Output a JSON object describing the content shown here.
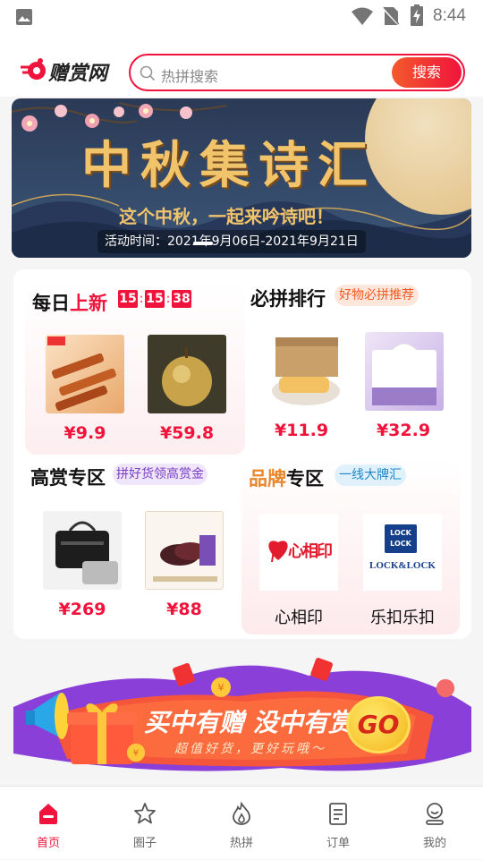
{
  "status_bar": {
    "time": "8:44"
  },
  "header": {
    "logo_text": "赠赏网",
    "search_placeholder": "热拼搜索",
    "search_button": "搜索"
  },
  "banner": {
    "title": "中秋集诗汇",
    "subtitle": "这个中秋，一起来吟诗吧！",
    "date_text": "活动时间：2021年9月06日-2021年9月21日"
  },
  "daily_new": {
    "title_a": "每日",
    "title_b": "上新",
    "countdown": [
      "15",
      "15",
      "38"
    ],
    "items": [
      {
        "price": "¥9.9"
      },
      {
        "price": "¥59.8"
      }
    ]
  },
  "must_group": {
    "title": "必拼排行",
    "tag": "好物必拼推荐",
    "items": [
      {
        "price": "¥11.9"
      },
      {
        "price": "¥32.9"
      }
    ]
  },
  "high_reward": {
    "title": "高赏专区",
    "tag": "拼好货领高赏金",
    "items": [
      {
        "price": "¥269"
      },
      {
        "price": "¥88"
      }
    ]
  },
  "brand_zone": {
    "title_a": "品牌",
    "title_b": "专区",
    "tag": "一线大牌汇",
    "brands": [
      {
        "name": "心相印",
        "logo_text": "心相印"
      },
      {
        "name": "乐扣乐扣",
        "logo_text_top": "LOCK",
        "logo_text_mid": "LOCK",
        "logo_text_bottom": "LOCK&LOCK"
      }
    ]
  },
  "promo": {
    "headline": "买中有赠 没中有赏",
    "sub": "超值好货，更好玩哦～",
    "go": "GO"
  },
  "tabs": [
    {
      "label": "首页",
      "icon": "home-icon",
      "active": true
    },
    {
      "label": "圈子",
      "icon": "star-icon",
      "active": false
    },
    {
      "label": "热拼",
      "icon": "flame-icon",
      "active": false
    },
    {
      "label": "订单",
      "icon": "order-icon",
      "active": false
    },
    {
      "label": "我的",
      "icon": "profile-icon",
      "active": false
    }
  ],
  "colors": {
    "accent": "#f0143c",
    "search_btn": "#f23a3a",
    "brand_orange": "#e8862a"
  }
}
